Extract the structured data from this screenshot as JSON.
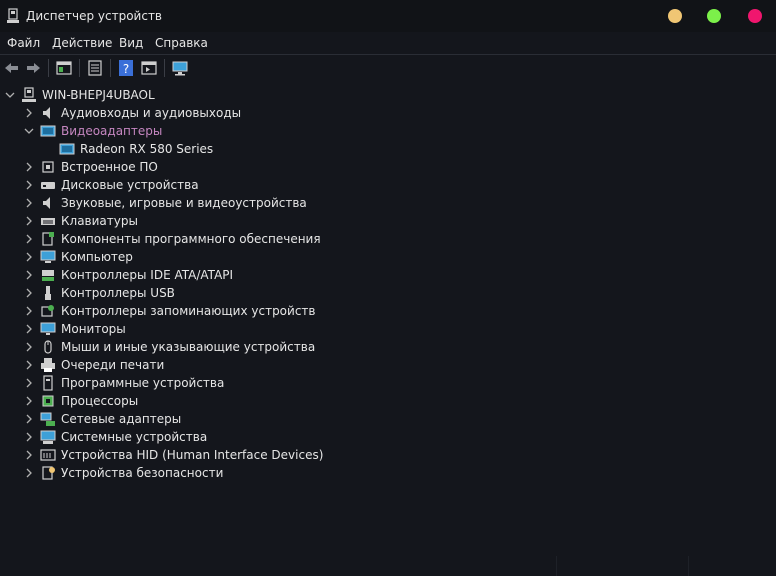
{
  "window": {
    "title": "Диспетчер устройств",
    "controls": [
      {
        "name": "minimize-button",
        "color": "#f0c674"
      },
      {
        "name": "maximize-button",
        "color": "#7cf04a"
      },
      {
        "name": "close-button",
        "color": "#f0166e"
      }
    ]
  },
  "menu": [
    "Файл",
    "Действие",
    "Вид",
    "Справка"
  ],
  "toolbar": {
    "buttons": [
      "back-icon",
      "forward-icon",
      "properties-icon",
      "update-driver-icon",
      "help-icon",
      "show-hidden-icon",
      "monitor-scan-icon"
    ]
  },
  "tree": {
    "root": "WIN-BHEPJ4UBAOL",
    "categories": [
      {
        "label": "Аудиовходы и аудиовыходы",
        "icon": "speaker-icon",
        "expanded": false
      },
      {
        "label": "Видеоадаптеры",
        "icon": "display-adapter-icon",
        "expanded": true,
        "selected": true,
        "children": [
          {
            "label": "Radeon RX 580 Series",
            "icon": "display-adapter-icon"
          }
        ]
      },
      {
        "label": "Встроенное ПО",
        "icon": "chip-icon",
        "expanded": false
      },
      {
        "label": "Дисковые устройства",
        "icon": "disk-icon",
        "expanded": false
      },
      {
        "label": "Звуковые, игровые и видеоустройства",
        "icon": "speaker-icon",
        "expanded": false
      },
      {
        "label": "Клавиатуры",
        "icon": "keyboard-icon",
        "expanded": false
      },
      {
        "label": "Компоненты программного обеспечения",
        "icon": "software-component-icon",
        "expanded": false
      },
      {
        "label": "Компьютер",
        "icon": "computer-icon",
        "expanded": false
      },
      {
        "label": "Контроллеры IDE ATA/ATAPI",
        "icon": "ide-controller-icon",
        "expanded": false
      },
      {
        "label": "Контроллеры USB",
        "icon": "usb-icon",
        "expanded": false
      },
      {
        "label": "Контроллеры запоминающих устройств",
        "icon": "storage-controller-icon",
        "expanded": false
      },
      {
        "label": "Мониторы",
        "icon": "monitor-icon",
        "expanded": false
      },
      {
        "label": "Мыши и иные указывающие устройства",
        "icon": "mouse-icon",
        "expanded": false
      },
      {
        "label": "Очереди печати",
        "icon": "printer-icon",
        "expanded": false
      },
      {
        "label": "Программные устройства",
        "icon": "software-device-icon",
        "expanded": false
      },
      {
        "label": "Процессоры",
        "icon": "processor-icon",
        "expanded": false
      },
      {
        "label": "Сетевые адаптеры",
        "icon": "network-adapter-icon",
        "expanded": false
      },
      {
        "label": "Системные устройства",
        "icon": "system-device-icon",
        "expanded": false
      },
      {
        "label": "Устройства HID (Human Interface Devices)",
        "icon": "hid-icon",
        "expanded": false
      },
      {
        "label": "Устройства безопасности",
        "icon": "security-device-icon",
        "expanded": false
      }
    ]
  },
  "colors": {
    "background": "#14161c",
    "text": "#e6e6e6",
    "selected_text": "#c586c0",
    "icon_blue": "#3da0d8"
  }
}
